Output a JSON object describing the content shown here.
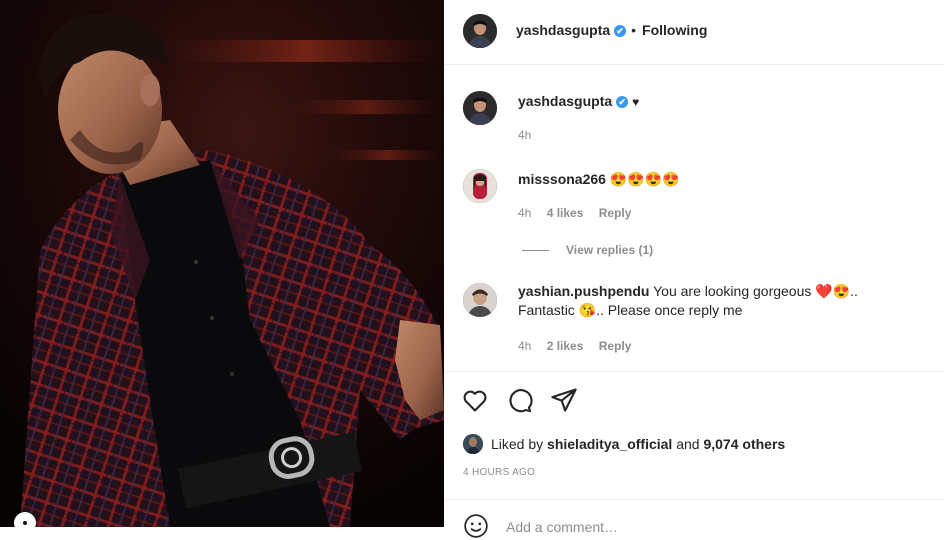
{
  "post": {
    "author": "yashdasgupta",
    "follow_separator": "•",
    "follow_status": "Following",
    "verified_mark": "✔"
  },
  "comments": [
    {
      "username": "yashdasgupta",
      "text": "♥",
      "time": "4h",
      "verified": true
    },
    {
      "username": "misssona266",
      "text": "😍😍😍😍",
      "time": "4h",
      "likes": "4 likes",
      "reply": "Reply",
      "view_replies": "View replies (1)"
    },
    {
      "username": "yashian.pushpendu",
      "text_part1": "You are looking gorgeous",
      "emoji_a": "❤️😍",
      "text_part2": ".. Fantastic",
      "emoji_b": "😘",
      "text_part3": ".. Please once reply me",
      "time": "4h",
      "likes": "2 likes",
      "reply": "Reply"
    }
  ],
  "actions": {
    "like_icon": "heart-outline-icon",
    "comment_icon": "comment-bubble-icon",
    "share_icon": "paper-plane-icon"
  },
  "likes": {
    "prefix": "Liked by",
    "user": "shieladitya_official",
    "middle": "and",
    "count": "9,074 others"
  },
  "timestamp": "4 HOURS AGO",
  "add_comment": {
    "placeholder": "Add a comment…"
  },
  "colors": {
    "verified_blue": "#3897f0",
    "meta_gray": "#8e8e8e",
    "text_dark": "#262626",
    "divider": "#efefef"
  }
}
